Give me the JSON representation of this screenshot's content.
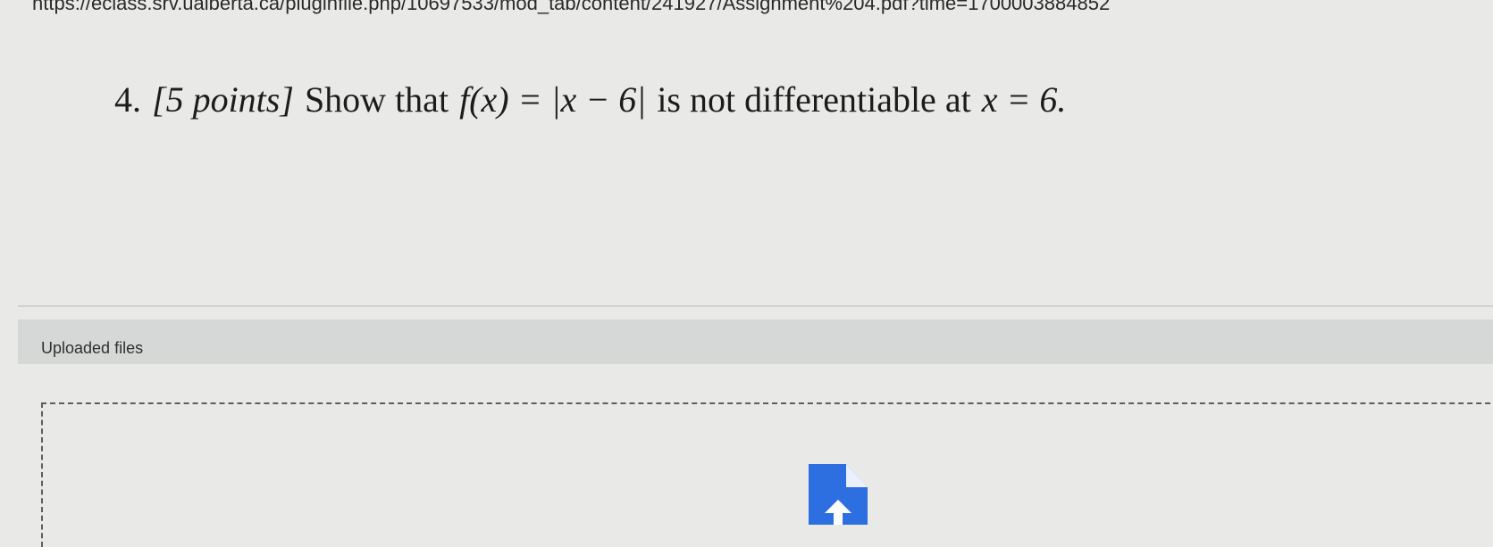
{
  "browser": {
    "url_text": "https://eclass.srv.ualberta.ca/pluginfile.php/10697533/mod_tab/content/241927/Assignment%204.pdf?time=1700003884852"
  },
  "question": {
    "number": "4.",
    "points": "[5 points]",
    "statement_prefix": "Show that",
    "function_expression": "f(x) = |x − 6|",
    "statement_suffix": "is not differentiable at",
    "point_expression": "x = 6."
  },
  "uploaded_files": {
    "label": "Uploaded files"
  },
  "colors": {
    "page_background": "#e9e9e7",
    "header_band": "#d6d8d7",
    "file_icon_blue": "#2d6fe0"
  },
  "icons": {
    "upload": "file-upload-icon"
  }
}
